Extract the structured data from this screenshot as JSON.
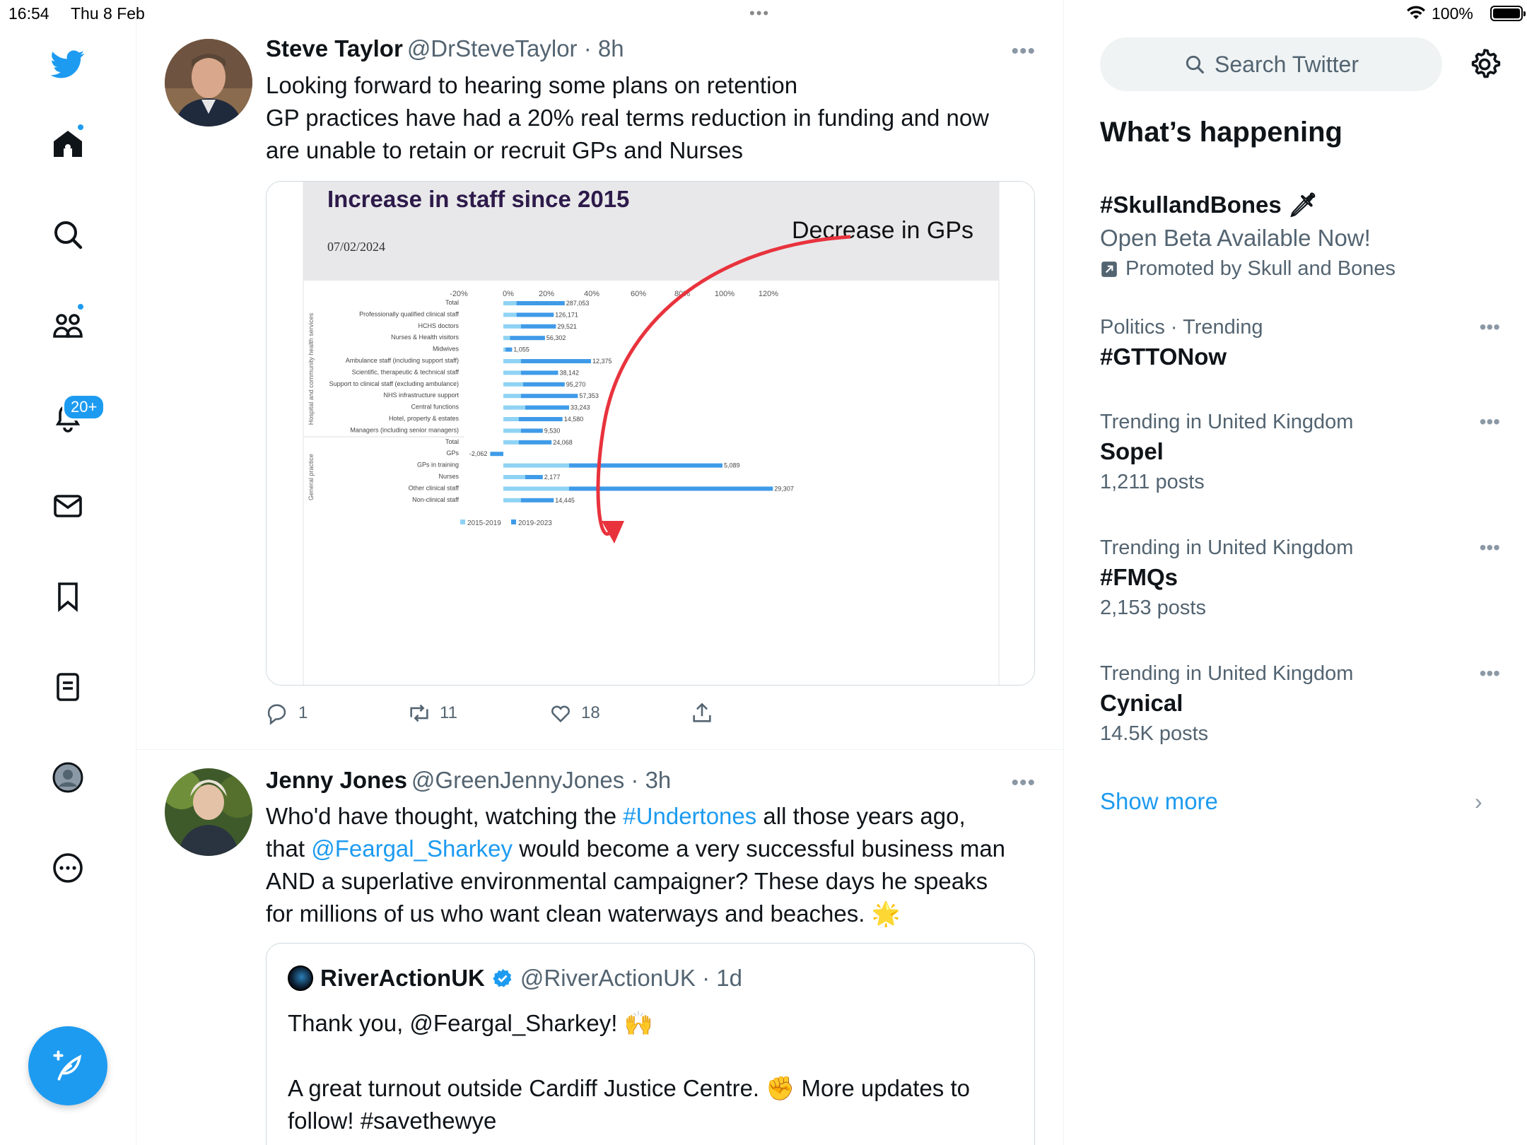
{
  "status_bar": {
    "time": "16:54",
    "date": "Thu 8 Feb",
    "battery": "100%",
    "center_dots": "•••"
  },
  "nav": {
    "notifications_badge": "20+"
  },
  "tweets": [
    {
      "name": "Steve Taylor",
      "handle": "@DrSteveTaylor · 8h",
      "text_lines": [
        "Looking forward to hearing some plans on retention",
        "GP practices have had a 20% real terms reduction in funding and now",
        "are unable to retain or recruit GPs and Nurses"
      ],
      "more": "•••",
      "replies": "1",
      "retweets": "11",
      "likes": "18"
    },
    {
      "name": "Jenny Jones",
      "handle": "@GreenJennyJones · 3h",
      "more": "•••",
      "text": {
        "l1_a": "Who'd have thought, watching the ",
        "l1_link": "#Undertones",
        "l1_b": " all those years ago,",
        "l2_a": "that ",
        "l2_link": "@Feargal_Sharkey",
        "l2_b": " would become a very successful business man",
        "l3": "AND a superlative environmental campaigner? These days he speaks",
        "l4": "for millions of us who want clean waterways and beaches. 🌟"
      },
      "quote": {
        "name": "RiverActionUK",
        "handle": "@RiverActionUK · 1d",
        "line1": "Thank you, @Feargal_Sharkey! 🙌",
        "line2": "A great turnout outside Cardiff Justice Centre. ✊ More updates to",
        "line3": "follow! #savethewye"
      }
    }
  ],
  "chart_data": {
    "type": "bar",
    "title": "Increase in staff since 2015",
    "date": "07/02/2024",
    "annotation": "Decrease in GPs",
    "x_ticks": [
      "-20%",
      "0%",
      "20%",
      "40%",
      "60%",
      "80%",
      "100%",
      "120%"
    ],
    "xlim": [
      -20,
      125
    ],
    "group_labels": [
      "Hospital and community health services",
      "General practice"
    ],
    "legend": [
      "2015-2019",
      "2019-2023"
    ],
    "categories": [
      "Total",
      "Professionally qualified clinical staff",
      "HCHS doctors",
      "Nurses & Health visitors",
      "Midwives",
      "Ambulance staff (including support staff)",
      "Scientific, therapeutic & technical staff",
      "Support to clinical staff (excluding ambulance)",
      "NHS infrastructure support",
      "Central functions",
      "Hotel, property & estates",
      "Managers (including senior managers)",
      "Total",
      "GPs",
      "GPs in training",
      "Nurses",
      "Other clinical staff",
      "Non-clinical staff"
    ],
    "series": [
      {
        "name": "2015-2019",
        "values": [
          6,
          6,
          8,
          3,
          1,
          8,
          8,
          9,
          8,
          10,
          7,
          8,
          7,
          -6,
          30,
          10,
          30,
          8
        ]
      },
      {
        "name": "2019-2023",
        "values": [
          22,
          17,
          16,
          16,
          3,
          32,
          17,
          19,
          26,
          20,
          20,
          10,
          15,
          0,
          70,
          8,
          93,
          15
        ]
      }
    ],
    "data_labels": [
      "287,053",
      "126,171",
      "29,521",
      "56,302",
      "1,055",
      "12,375",
      "38,142",
      "95,270",
      "57,353",
      "33,243",
      "14,580",
      "9,530",
      "24,068",
      "-2,062",
      "5,089",
      "2,177",
      "29,307",
      "14,445"
    ],
    "colors": {
      "s1": "#8fd3f4",
      "s2": "#3f9be8",
      "arrow": "#e8333d",
      "header_bg": "#e8e8ea",
      "title": "#2d1a4a"
    }
  },
  "sidebar": {
    "search_placeholder": "Search Twitter",
    "heading": "What’s happening",
    "trends": [
      {
        "meta": "",
        "name": "#SkullandBones 🗡",
        "sub": "Open Beta Available Now!",
        "promo": "Promoted by Skull and Bones"
      },
      {
        "meta": "Politics · Trending",
        "name": "#GTTONow",
        "sub": ""
      },
      {
        "meta": "Trending in United Kingdom",
        "name": "Sopel",
        "sub": "1,211 posts"
      },
      {
        "meta": "Trending in United Kingdom",
        "name": "#FMQs",
        "sub": "2,153 posts"
      },
      {
        "meta": "Trending in United Kingdom",
        "name": "Cynical",
        "sub": "14.5K posts"
      }
    ],
    "show_more": "Show more",
    "trend_dots": "•••"
  }
}
